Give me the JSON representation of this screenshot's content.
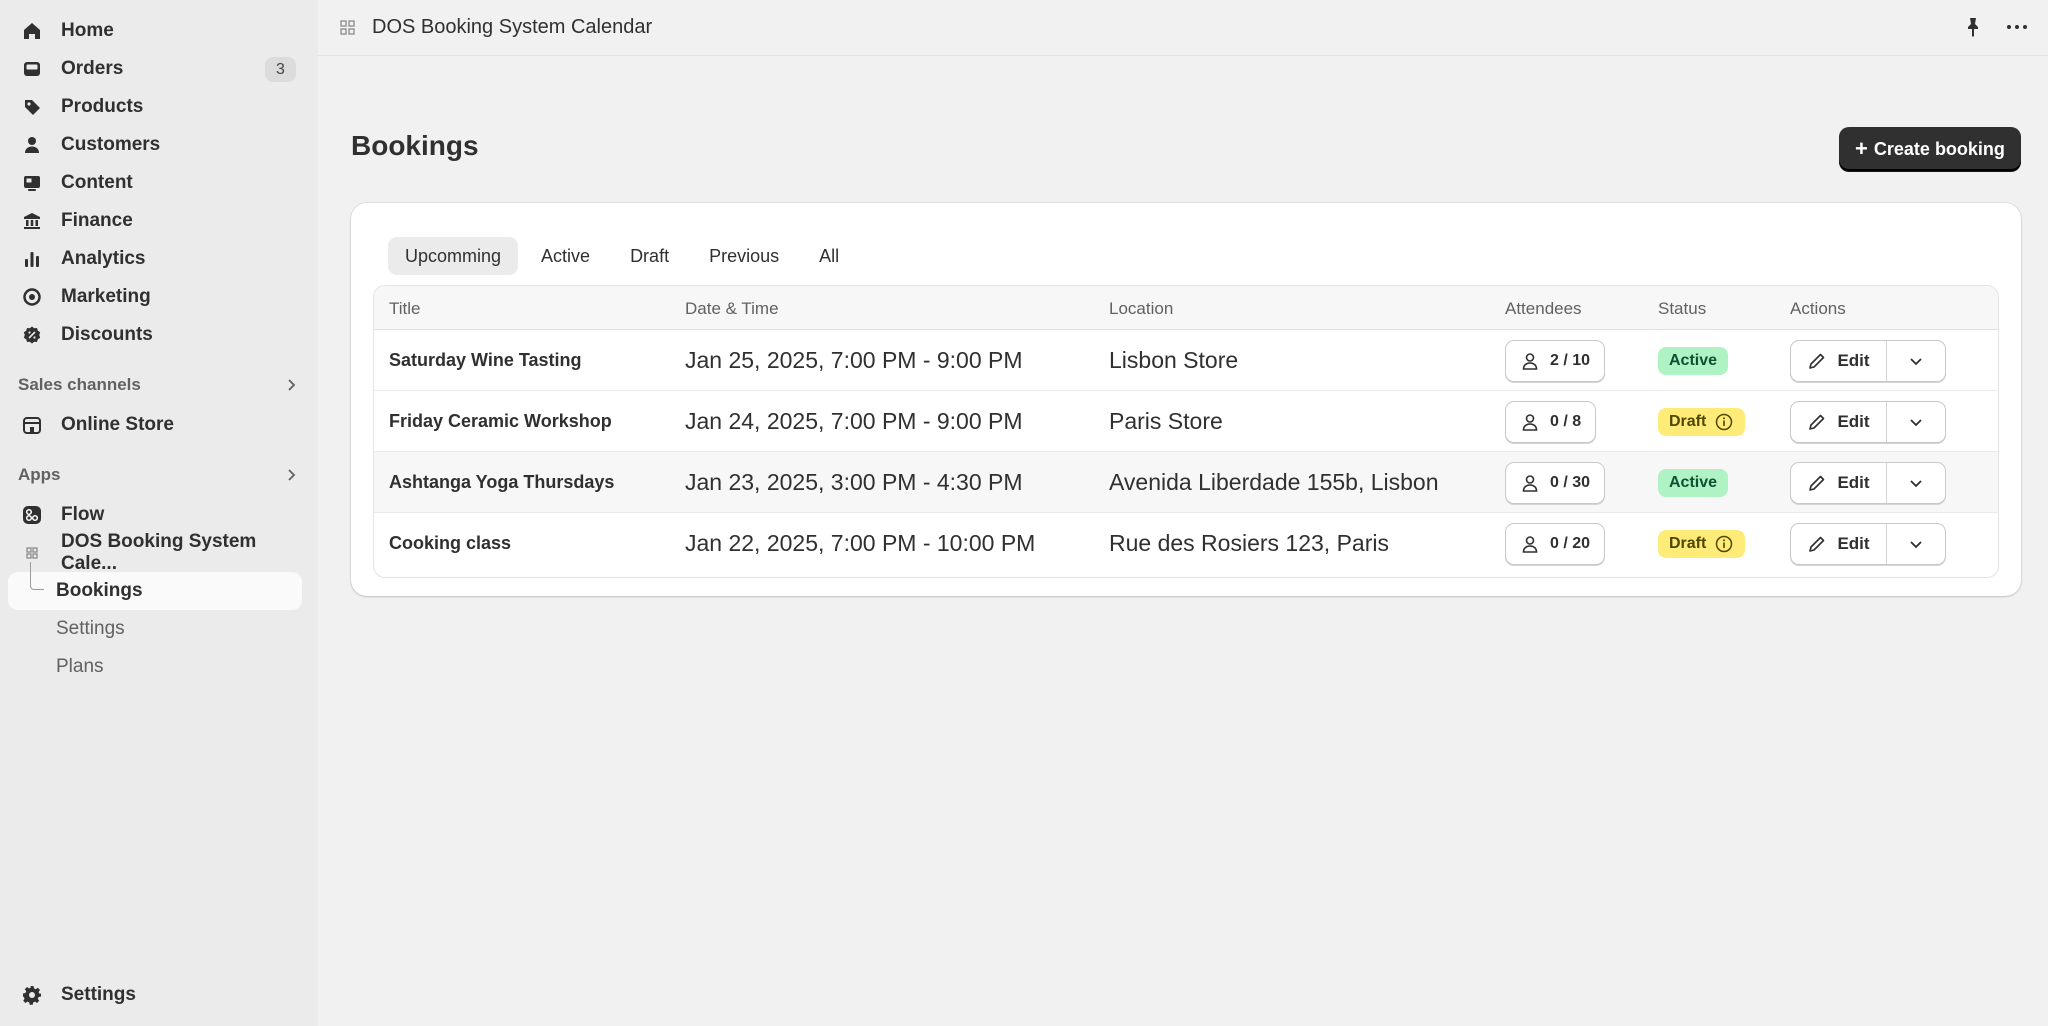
{
  "sidebar": {
    "items": [
      {
        "label": "Home",
        "icon": "home-icon"
      },
      {
        "label": "Orders",
        "icon": "inbox-icon",
        "badge": "3"
      },
      {
        "label": "Products",
        "icon": "tag-icon"
      },
      {
        "label": "Customers",
        "icon": "person-icon"
      },
      {
        "label": "Content",
        "icon": "content-icon"
      },
      {
        "label": "Finance",
        "icon": "bank-icon"
      },
      {
        "label": "Analytics",
        "icon": "bar-chart-icon"
      },
      {
        "label": "Marketing",
        "icon": "target-icon"
      },
      {
        "label": "Discounts",
        "icon": "discount-icon"
      }
    ],
    "sales_channels": {
      "heading": "Sales channels",
      "items": [
        {
          "label": "Online Store",
          "icon": "store-icon"
        }
      ]
    },
    "apps": {
      "heading": "Apps",
      "items": [
        {
          "label": "Flow",
          "icon": "flow-icon"
        },
        {
          "label": "DOS Booking System Cale...",
          "icon": "app-grid-icon"
        }
      ],
      "sub_items": [
        "Bookings",
        "Settings",
        "Plans"
      ]
    },
    "bottom": {
      "label": "Settings",
      "icon": "gear-icon"
    }
  },
  "topbar": {
    "title": "DOS Booking System Calendar"
  },
  "page": {
    "title": "Bookings",
    "create_label": "Create booking"
  },
  "tabs": [
    "Upcomming",
    "Active",
    "Draft",
    "Previous",
    "All"
  ],
  "table": {
    "headers": {
      "title": "Title",
      "date": "Date & Time",
      "location": "Location",
      "attendees": "Attendees",
      "status": "Status",
      "actions": "Actions"
    },
    "edit_label": "Edit",
    "rows": [
      {
        "title": "Saturday Wine Tasting",
        "date": "Jan 25, 2025, 7:00 PM - 9:00 PM",
        "location": "Lisbon Store",
        "attendees": "2 / 10",
        "status": "Active"
      },
      {
        "title": "Friday Ceramic Workshop",
        "date": "Jan 24, 2025, 7:00 PM - 9:00 PM",
        "location": "Paris Store",
        "attendees": "0 / 8",
        "status": "Draft"
      },
      {
        "title": "Ashtanga Yoga Thursdays",
        "date": "Jan 23, 2025, 3:00 PM - 4:30 PM",
        "location": "Avenida Liberdade 155b, Lisbon",
        "attendees": "0 / 30",
        "status": "Active"
      },
      {
        "title": "Cooking class",
        "date": "Jan 22, 2025, 7:00 PM - 10:00 PM",
        "location": "Rue des Rosiers 123, Paris",
        "attendees": "0 / 20",
        "status": "Draft"
      }
    ]
  },
  "colors": {
    "active_badge": "#aff2c4",
    "draft_badge": "#ffeb78",
    "primary_button": "#303030"
  }
}
